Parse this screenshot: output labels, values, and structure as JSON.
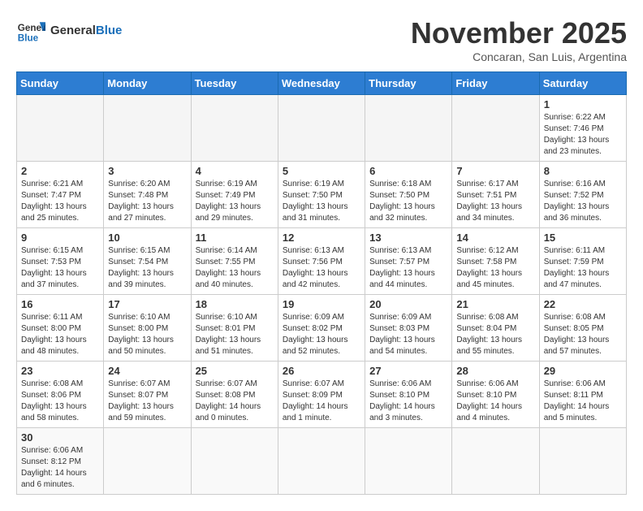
{
  "header": {
    "logo_text_general": "General",
    "logo_text_blue": "Blue",
    "month_title": "November 2025",
    "subtitle": "Concaran, San Luis, Argentina"
  },
  "weekdays": [
    "Sunday",
    "Monday",
    "Tuesday",
    "Wednesday",
    "Thursday",
    "Friday",
    "Saturday"
  ],
  "weeks": [
    [
      {
        "day": "",
        "info": ""
      },
      {
        "day": "",
        "info": ""
      },
      {
        "day": "",
        "info": ""
      },
      {
        "day": "",
        "info": ""
      },
      {
        "day": "",
        "info": ""
      },
      {
        "day": "",
        "info": ""
      },
      {
        "day": "1",
        "info": "Sunrise: 6:22 AM\nSunset: 7:46 PM\nDaylight: 13 hours\nand 23 minutes."
      }
    ],
    [
      {
        "day": "2",
        "info": "Sunrise: 6:21 AM\nSunset: 7:47 PM\nDaylight: 13 hours\nand 25 minutes."
      },
      {
        "day": "3",
        "info": "Sunrise: 6:20 AM\nSunset: 7:48 PM\nDaylight: 13 hours\nand 27 minutes."
      },
      {
        "day": "4",
        "info": "Sunrise: 6:19 AM\nSunset: 7:49 PM\nDaylight: 13 hours\nand 29 minutes."
      },
      {
        "day": "5",
        "info": "Sunrise: 6:19 AM\nSunset: 7:50 PM\nDaylight: 13 hours\nand 31 minutes."
      },
      {
        "day": "6",
        "info": "Sunrise: 6:18 AM\nSunset: 7:50 PM\nDaylight: 13 hours\nand 32 minutes."
      },
      {
        "day": "7",
        "info": "Sunrise: 6:17 AM\nSunset: 7:51 PM\nDaylight: 13 hours\nand 34 minutes."
      },
      {
        "day": "8",
        "info": "Sunrise: 6:16 AM\nSunset: 7:52 PM\nDaylight: 13 hours\nand 36 minutes."
      }
    ],
    [
      {
        "day": "9",
        "info": "Sunrise: 6:15 AM\nSunset: 7:53 PM\nDaylight: 13 hours\nand 37 minutes."
      },
      {
        "day": "10",
        "info": "Sunrise: 6:15 AM\nSunset: 7:54 PM\nDaylight: 13 hours\nand 39 minutes."
      },
      {
        "day": "11",
        "info": "Sunrise: 6:14 AM\nSunset: 7:55 PM\nDaylight: 13 hours\nand 40 minutes."
      },
      {
        "day": "12",
        "info": "Sunrise: 6:13 AM\nSunset: 7:56 PM\nDaylight: 13 hours\nand 42 minutes."
      },
      {
        "day": "13",
        "info": "Sunrise: 6:13 AM\nSunset: 7:57 PM\nDaylight: 13 hours\nand 44 minutes."
      },
      {
        "day": "14",
        "info": "Sunrise: 6:12 AM\nSunset: 7:58 PM\nDaylight: 13 hours\nand 45 minutes."
      },
      {
        "day": "15",
        "info": "Sunrise: 6:11 AM\nSunset: 7:59 PM\nDaylight: 13 hours\nand 47 minutes."
      }
    ],
    [
      {
        "day": "16",
        "info": "Sunrise: 6:11 AM\nSunset: 8:00 PM\nDaylight: 13 hours\nand 48 minutes."
      },
      {
        "day": "17",
        "info": "Sunrise: 6:10 AM\nSunset: 8:00 PM\nDaylight: 13 hours\nand 50 minutes."
      },
      {
        "day": "18",
        "info": "Sunrise: 6:10 AM\nSunset: 8:01 PM\nDaylight: 13 hours\nand 51 minutes."
      },
      {
        "day": "19",
        "info": "Sunrise: 6:09 AM\nSunset: 8:02 PM\nDaylight: 13 hours\nand 52 minutes."
      },
      {
        "day": "20",
        "info": "Sunrise: 6:09 AM\nSunset: 8:03 PM\nDaylight: 13 hours\nand 54 minutes."
      },
      {
        "day": "21",
        "info": "Sunrise: 6:08 AM\nSunset: 8:04 PM\nDaylight: 13 hours\nand 55 minutes."
      },
      {
        "day": "22",
        "info": "Sunrise: 6:08 AM\nSunset: 8:05 PM\nDaylight: 13 hours\nand 57 minutes."
      }
    ],
    [
      {
        "day": "23",
        "info": "Sunrise: 6:08 AM\nSunset: 8:06 PM\nDaylight: 13 hours\nand 58 minutes."
      },
      {
        "day": "24",
        "info": "Sunrise: 6:07 AM\nSunset: 8:07 PM\nDaylight: 13 hours\nand 59 minutes."
      },
      {
        "day": "25",
        "info": "Sunrise: 6:07 AM\nSunset: 8:08 PM\nDaylight: 14 hours\nand 0 minutes."
      },
      {
        "day": "26",
        "info": "Sunrise: 6:07 AM\nSunset: 8:09 PM\nDaylight: 14 hours\nand 1 minute."
      },
      {
        "day": "27",
        "info": "Sunrise: 6:06 AM\nSunset: 8:10 PM\nDaylight: 14 hours\nand 3 minutes."
      },
      {
        "day": "28",
        "info": "Sunrise: 6:06 AM\nSunset: 8:10 PM\nDaylight: 14 hours\nand 4 minutes."
      },
      {
        "day": "29",
        "info": "Sunrise: 6:06 AM\nSunset: 8:11 PM\nDaylight: 14 hours\nand 5 minutes."
      }
    ],
    [
      {
        "day": "30",
        "info": "Sunrise: 6:06 AM\nSunset: 8:12 PM\nDaylight: 14 hours\nand 6 minutes."
      },
      {
        "day": "",
        "info": ""
      },
      {
        "day": "",
        "info": ""
      },
      {
        "day": "",
        "info": ""
      },
      {
        "day": "",
        "info": ""
      },
      {
        "day": "",
        "info": ""
      },
      {
        "day": "",
        "info": ""
      }
    ]
  ]
}
